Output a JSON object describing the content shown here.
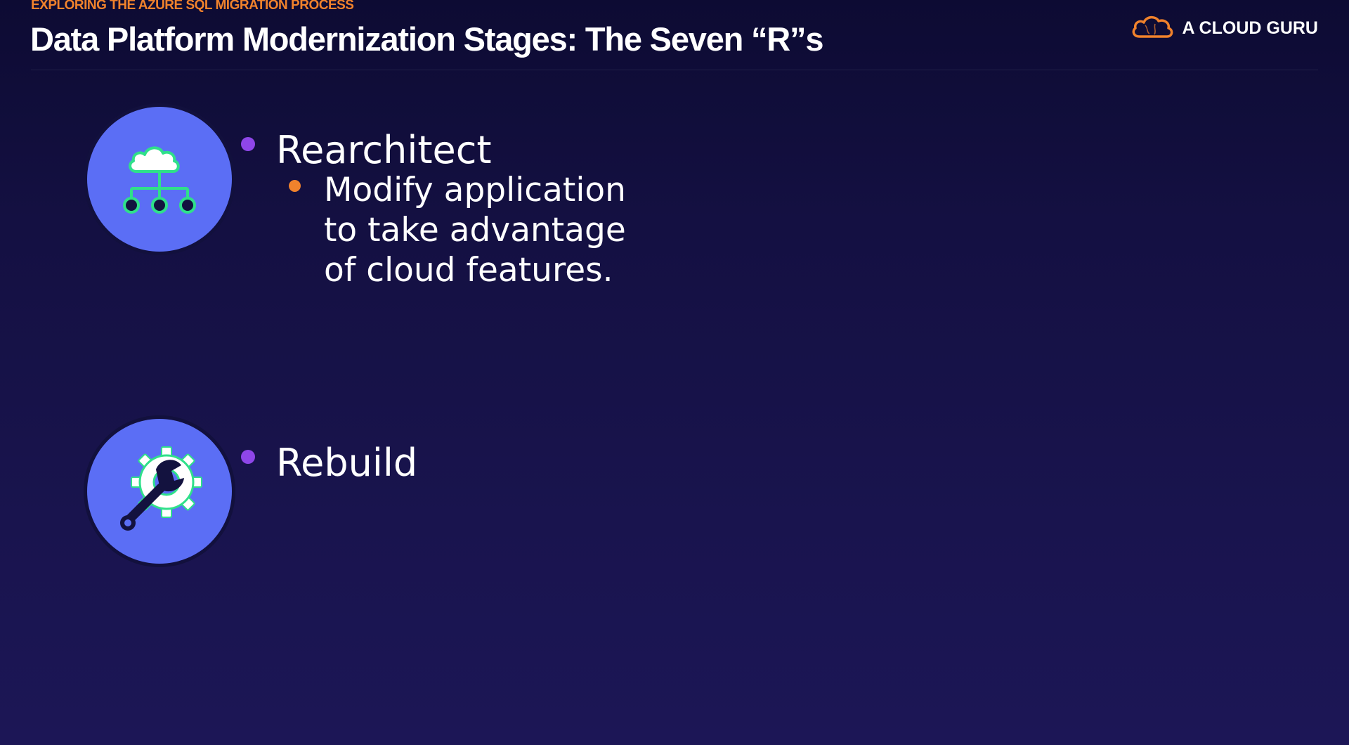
{
  "header": {
    "section_label": "EXPLORING THE AZURE SQL MIGRATION PROCESS",
    "title": "Data Platform Modernization Stages: The Seven “R”s"
  },
  "brand": {
    "name": "A CLOUD GURU",
    "logo_icon": "cloud-logo-icon"
  },
  "stages": [
    {
      "icon": "cloud-network-icon",
      "title": "Rearchitect",
      "description": "Modify application to take advantage of cloud features."
    },
    {
      "icon": "gear-wrench-icon",
      "title": "Rebuild"
    }
  ],
  "colors": {
    "background": "#17134a",
    "accent_orange": "#f0822c",
    "bullet_purple": "#8e46e8",
    "icon_circle": "#5b6ef5",
    "icon_green": "#2fe08a"
  }
}
